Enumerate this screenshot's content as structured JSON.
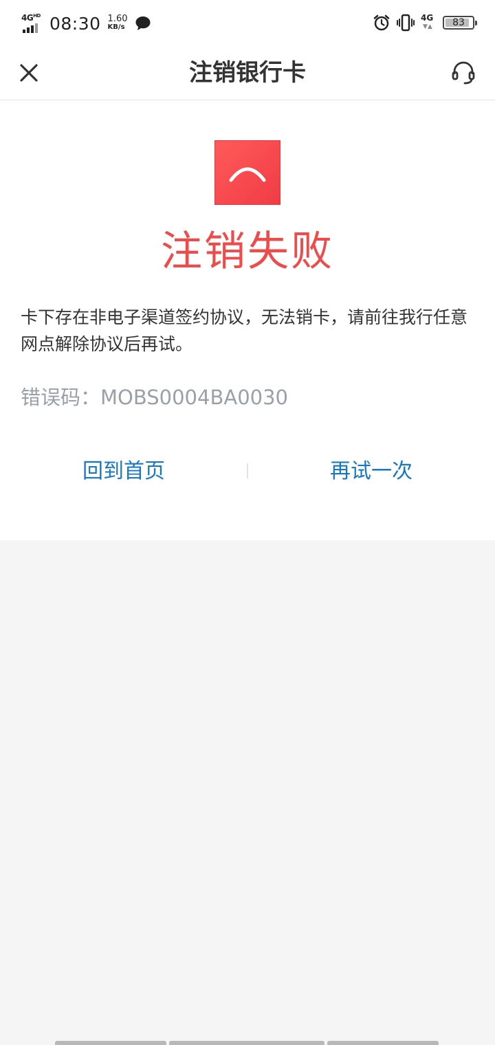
{
  "status_bar": {
    "network_type": "4G",
    "network_hd": "HD",
    "time": "08:30",
    "speed_value": "1.60",
    "speed_unit": "KB/s",
    "mobile_data": "4G",
    "battery_level": "83",
    "icons": [
      "signal-icon",
      "message-bubble-icon",
      "alarm-icon",
      "vibrate-icon",
      "battery-icon"
    ]
  },
  "nav": {
    "title": "注销银行卡",
    "close_icon": "close-icon",
    "service_icon": "headset-icon"
  },
  "result": {
    "icon": "sad-face-icon",
    "title": "注销失败",
    "message": "卡下存在非电子渠道签约协议，无法销卡，请前往我行任意网点解除协议后再试。",
    "error_label": "错误码：",
    "error_code": "MOBS0004BA0030"
  },
  "actions": {
    "home_label": "回到首页",
    "retry_label": "再试一次"
  },
  "colors": {
    "error_red": "#ee4b4b",
    "link_blue": "#1677c4",
    "muted_gray": "#9a9fa8",
    "background": "#f5f5f5"
  }
}
